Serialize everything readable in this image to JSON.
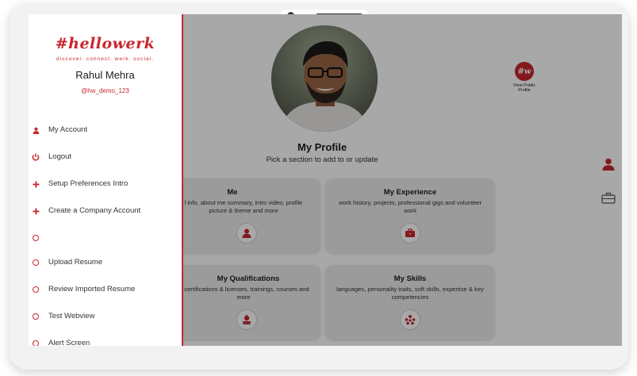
{
  "app": {
    "logo": "#hellowerk",
    "tagline": "discover. connect. werk. social."
  },
  "user": {
    "name": "Rahul Mehra",
    "handle": "@hw_demo_123"
  },
  "menu": {
    "items": [
      {
        "label": "My Account",
        "icon": "person-icon"
      },
      {
        "label": "Logout",
        "icon": "power-icon"
      },
      {
        "label": "Setup Preferences Intro",
        "icon": "plus-icon"
      },
      {
        "label": "Create a Company Account",
        "icon": "plus-icon"
      },
      {
        "label": "",
        "icon": "circle-icon"
      },
      {
        "label": "Upload Resume",
        "icon": "circle-icon"
      },
      {
        "label": "Review Imported Resume",
        "icon": "circle-icon"
      },
      {
        "label": "Test Webview",
        "icon": "circle-icon"
      },
      {
        "label": "Alert Screen",
        "icon": "circle-icon"
      }
    ]
  },
  "profile": {
    "title": "My Profile",
    "subtitle": "Pick a section to add to or update",
    "view_public": {
      "badge": "#w",
      "label": "View Public Profile"
    }
  },
  "cards": [
    {
      "title": "Me",
      "desc": "l info, about me summary, intro video, profile picture & theme and more",
      "icon": "person-icon"
    },
    {
      "title": "My Experience",
      "desc": "work history, projects, professional gigs and volunteer work",
      "icon": "briefcase-icon"
    },
    {
      "title": "My Qualifications",
      "desc": "c, certifications & licenses, trainings, courses and more",
      "icon": "apple-books-icon"
    },
    {
      "title": "My Skills",
      "desc": "languages, personality traits, soft skills, expertise & key competencies",
      "icon": "skills-icon"
    }
  ],
  "colors": {
    "brand_red": "#c9262c",
    "overlay": "rgba(0,0,0,0.34)"
  }
}
